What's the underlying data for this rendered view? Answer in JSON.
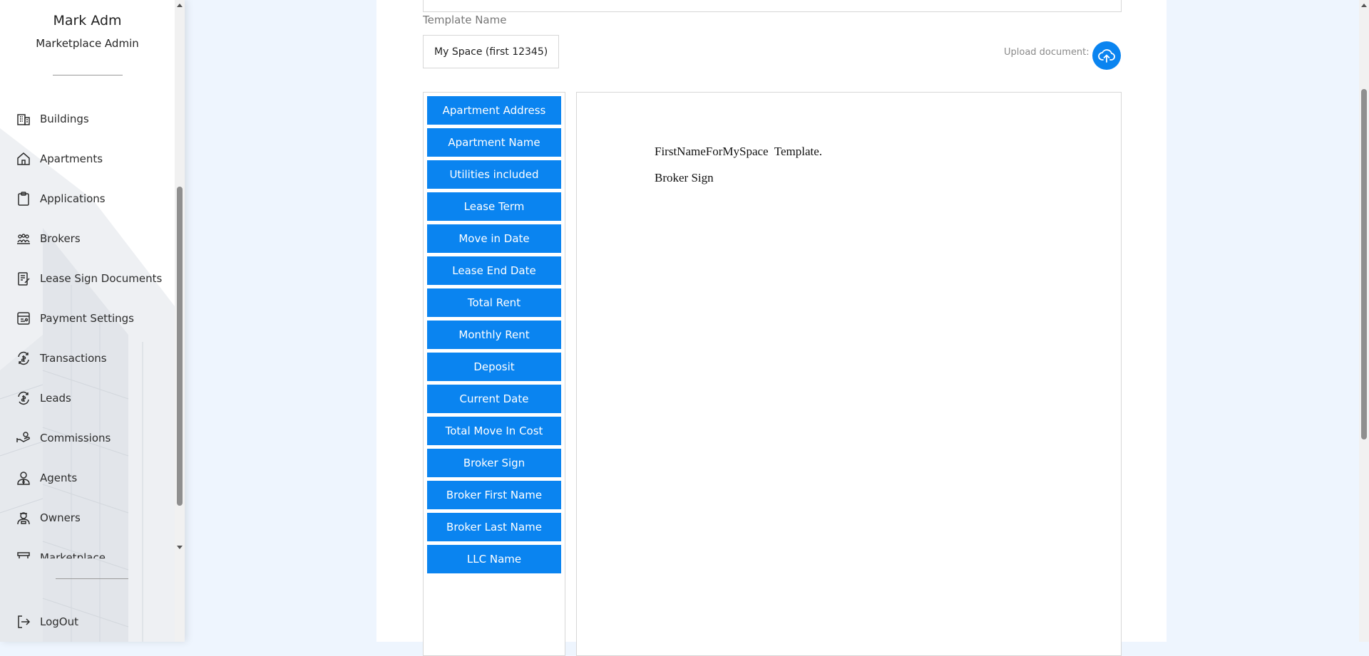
{
  "user": {
    "name": "Mark Adm",
    "role": "Marketplace Admin"
  },
  "sidebar": {
    "items": [
      {
        "label": "Buildings",
        "icon": "buildings-icon"
      },
      {
        "label": "Apartments",
        "icon": "home-icon"
      },
      {
        "label": "Applications",
        "icon": "clipboard-icon"
      },
      {
        "label": "Brokers",
        "icon": "brokers-icon"
      },
      {
        "label": "Lease Sign Documents",
        "icon": "document-sign-icon"
      },
      {
        "label": "Payment Settings",
        "icon": "payment-settings-icon"
      },
      {
        "label": "Transactions",
        "icon": "transactions-icon"
      },
      {
        "label": "Leads",
        "icon": "leads-icon"
      },
      {
        "label": "Commissions",
        "icon": "commissions-icon"
      },
      {
        "label": "Agents",
        "icon": "agent-icon"
      },
      {
        "label": "Owners",
        "icon": "owner-icon"
      },
      {
        "label": "Marketplace",
        "icon": "marketplace-icon"
      }
    ],
    "logout_label": "LogOut"
  },
  "template": {
    "label": "Template Name",
    "value": "My Space (first 12345)",
    "upload_label": "Upload document:"
  },
  "fields": [
    "Apartment Address",
    "Apartment Name",
    "Utilities included",
    "Lease Term",
    "Move in Date",
    "Lease End Date",
    "Total Rent",
    "Monthly Rent",
    "Deposit",
    "Current Date",
    "Total Move In Cost",
    "Broker Sign",
    "Broker First Name",
    "Broker Last Name",
    "LLC Name"
  ],
  "document": {
    "line1": "FirstNameForMySpace  Template.",
    "line2": "Broker Sign"
  },
  "colors": {
    "accent": "#0a84f0",
    "page_bg": "#eef5fe",
    "text": "#2d2d2d"
  }
}
